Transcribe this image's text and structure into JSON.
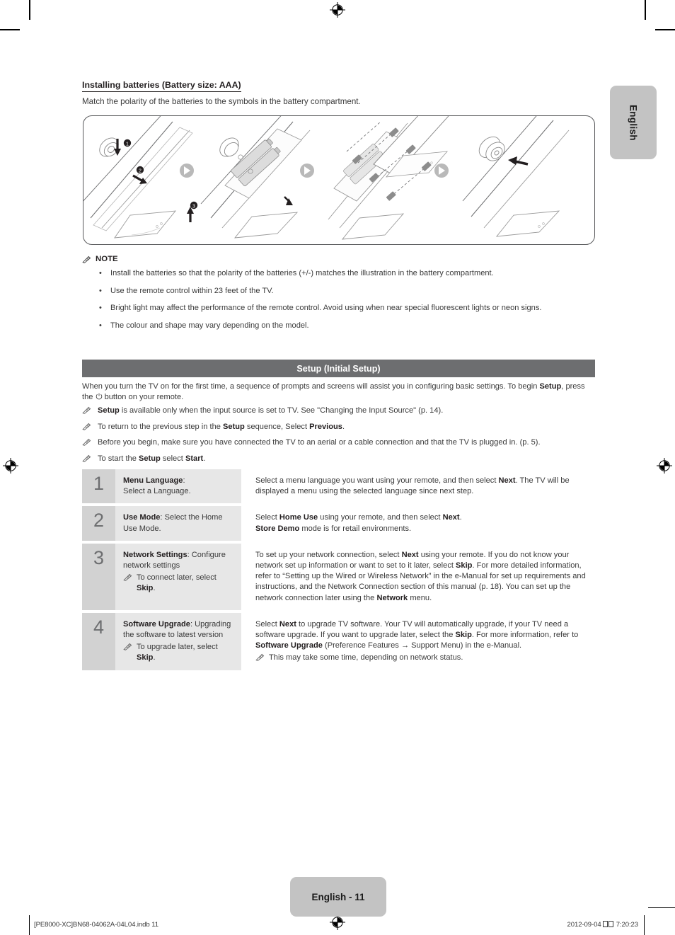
{
  "page": {
    "language_tab": "English",
    "page_label": "English - 11",
    "footer_left": "[PE8000-XC]BN68-04062A-04L04.indb   11",
    "footer_right_date": "2012-09-04",
    "footer_right_time": "7:20:23"
  },
  "battery_section": {
    "title": "Installing batteries (Battery size: AAA)",
    "subtitle": "Match the polarity of the batteries to the symbols in the battery compartment.",
    "illustration_name": "remote-control-battery-installation-diagram"
  },
  "note": {
    "icon": "note-pencil-icon",
    "heading": "NOTE",
    "items": [
      "Install the batteries so that the polarity of the batteries (+/-) matches the illustration in the battery compartment.",
      "Use the remote control within 23 feet of the TV.",
      "Bright light may affect the performance of the remote control. Avoid using when near special fluorescent lights or neon signs.",
      "The colour and shape may vary depending on the model."
    ]
  },
  "setup": {
    "bar_title": "Setup (Initial Setup)",
    "intro_part1": "When you turn the TV on for the first time, a sequence of prompts and screens will assist you in configuring basic settings. To begin ",
    "intro_bold": "Setup",
    "intro_part2": ", press the ",
    "intro_power_icon": "power-icon",
    "intro_part3": " button on your remote.",
    "tips": [
      {
        "icon": "note-pencil-icon",
        "segments": [
          {
            "text": "Setup",
            "bold": true
          },
          {
            "text": " is available only when the input source is set to TV. See \"Changing the Input Source\" (p. 14).",
            "bold": false
          }
        ]
      },
      {
        "icon": "note-pencil-icon",
        "segments": [
          {
            "text": "To return to the previous step in the ",
            "bold": false
          },
          {
            "text": "Setup",
            "bold": true
          },
          {
            "text": " sequence, Select ",
            "bold": false
          },
          {
            "text": "Previous",
            "bold": true
          },
          {
            "text": ".",
            "bold": false
          }
        ]
      },
      {
        "icon": "note-pencil-icon",
        "segments": [
          {
            "text": "Before you begin, make sure you have connected the TV to an aerial or a cable connection and that the TV is plugged in. (p. 5).",
            "bold": false
          }
        ]
      },
      {
        "icon": "note-pencil-icon",
        "segments": [
          {
            "text": "To start the ",
            "bold": false
          },
          {
            "text": "Setup",
            "bold": true
          },
          {
            "text": " select ",
            "bold": false
          },
          {
            "text": "Start",
            "bold": true
          },
          {
            "text": ".",
            "bold": false
          }
        ]
      }
    ],
    "steps": [
      {
        "number": "1",
        "label_segments": [
          {
            "text": "Menu Language",
            "bold": true
          },
          {
            "text": ":",
            "bold": false
          },
          {
            "text": "\n",
            "bold": false
          },
          {
            "text": "Select a Language.",
            "bold": false
          }
        ],
        "label_note": null,
        "desc_segments": [
          {
            "text": "Select a menu language you want using your remote, and then select ",
            "bold": false
          },
          {
            "text": "Next",
            "bold": true
          },
          {
            "text": ". The TV will be displayed a menu using the selected language since next step.",
            "bold": false
          }
        ],
        "desc_note": null
      },
      {
        "number": "2",
        "label_segments": [
          {
            "text": "Use Mode",
            "bold": true
          },
          {
            "text": ": Select the Home Use Mode.",
            "bold": false
          }
        ],
        "label_note": null,
        "desc_segments": [
          {
            "text": "Select ",
            "bold": false
          },
          {
            "text": "Home Use",
            "bold": true
          },
          {
            "text": " using your remote, and then select ",
            "bold": false
          },
          {
            "text": "Next",
            "bold": true
          },
          {
            "text": ".",
            "bold": false
          },
          {
            "text": "\n",
            "bold": false
          },
          {
            "text": "Store Demo",
            "bold": true
          },
          {
            "text": " mode is for retail environments.",
            "bold": false
          }
        ],
        "desc_note": null
      },
      {
        "number": "3",
        "label_segments": [
          {
            "text": "Network Settings",
            "bold": true
          },
          {
            "text": ": Configure network settings",
            "bold": false
          }
        ],
        "label_note": {
          "icon": "note-pencil-icon",
          "segments": [
            {
              "text": "To connect later, select ",
              "bold": false
            },
            {
              "text": "Skip",
              "bold": true
            },
            {
              "text": ".",
              "bold": false
            }
          ]
        },
        "desc_segments": [
          {
            "text": "To set up your network connection, select ",
            "bold": false
          },
          {
            "text": "Next",
            "bold": true
          },
          {
            "text": " using your remote. If you do not know your network set up information or want to set to it later, select ",
            "bold": false
          },
          {
            "text": "Skip",
            "bold": true
          },
          {
            "text": ". For more detailed information, refer to “Setting up the Wired or Wireless Network” in the e-Manual for set up requirements and instructions, and the Network Connection section of this manual (p. 18). You can set up the network connection later using the ",
            "bold": false
          },
          {
            "text": "Network",
            "bold": true
          },
          {
            "text": " menu.",
            "bold": false
          }
        ],
        "desc_note": null
      },
      {
        "number": "4",
        "label_segments": [
          {
            "text": "Software Upgrade",
            "bold": true
          },
          {
            "text": ": Upgrading the software to latest version",
            "bold": false
          }
        ],
        "label_note": {
          "icon": "note-pencil-icon",
          "segments": [
            {
              "text": "To upgrade later, select ",
              "bold": false
            },
            {
              "text": "Skip",
              "bold": true
            },
            {
              "text": ".",
              "bold": false
            }
          ]
        },
        "desc_segments": [
          {
            "text": "Select ",
            "bold": false
          },
          {
            "text": "Next",
            "bold": true
          },
          {
            "text": " to upgrade TV software. Your TV will automatically upgrade, if your TV need a software upgrade. If you want to upgrade later, select the ",
            "bold": false
          },
          {
            "text": "Skip",
            "bold": true
          },
          {
            "text": ". For more information, refer to ",
            "bold": false
          },
          {
            "text": "Software Upgrade",
            "bold": true
          },
          {
            "text": " (Preference Features → Support Menu) in the e-Manual.",
            "bold": false
          }
        ],
        "desc_note": {
          "icon": "note-pencil-icon",
          "segments": [
            {
              "text": "This may take some time, depending on network status.",
              "bold": false
            }
          ]
        }
      }
    ]
  },
  "colors": {
    "bar_bg": "#6d6e70",
    "step_num_bg": "#d2d2d2",
    "step_label_bg": "#e7e7e7",
    "tab_bg": "#c3c3c3",
    "text": "#3a3a3a"
  }
}
